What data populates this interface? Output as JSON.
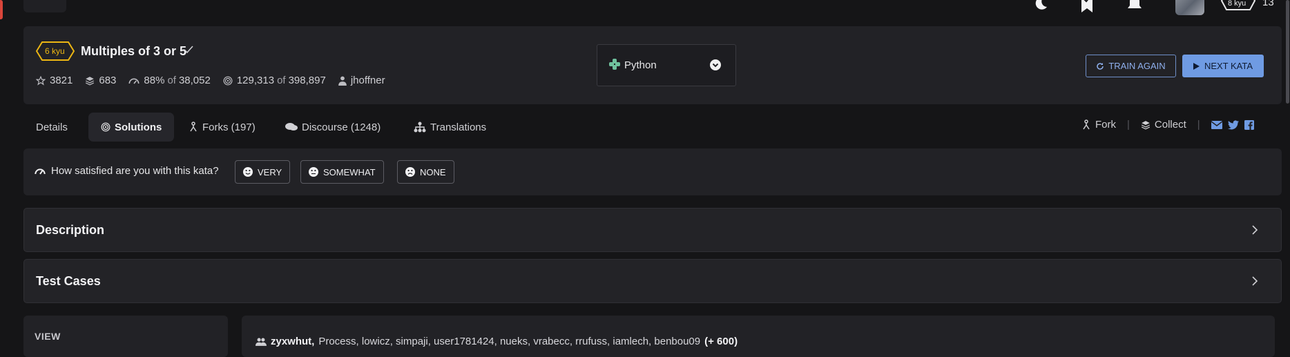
{
  "topbar": {
    "rank_label": "8 kyu",
    "honor": "13",
    "icons": [
      "moon-icon",
      "bookmark-icon",
      "bell-icon",
      "avatar"
    ]
  },
  "kata": {
    "rank": "6 kyu",
    "title": "Multiples of 3 or 5",
    "stats": {
      "stars": "3821",
      "collections": "683",
      "satisfaction": "88%",
      "satisfaction_of": "of",
      "satisfaction_votes": "38,052",
      "completions": "129,313",
      "completions_of": "of",
      "attempts": "398,897",
      "author": "jhoffner"
    }
  },
  "language": {
    "selected": "Python"
  },
  "actions": {
    "train_again": "TRAIN AGAIN",
    "next_kata": "NEXT KATA"
  },
  "tabs": [
    {
      "label": "Details"
    },
    {
      "label": "Solutions"
    },
    {
      "label": "Forks (197)"
    },
    {
      "label": "Discourse (1248)"
    },
    {
      "label": "Translations"
    }
  ],
  "right_actions": {
    "fork": "Fork",
    "collect": "Collect",
    "separator": "|"
  },
  "satisfaction": {
    "question": "How satisfied are you with this kata?",
    "options": [
      "VERY",
      "SOMEWHAT",
      "NONE"
    ]
  },
  "sections": {
    "description": "Description",
    "test_cases": "Test Cases"
  },
  "sidebar": {
    "view_label": "VIEW"
  },
  "solution": {
    "first_author": "zyxwhut,",
    "others": "Process, lowicz, simpaji, user1781424, nueks, vrabecc, rrufuss, iamlech, benbou09",
    "more": "(+ 600)"
  },
  "colors": {
    "background": "#151517",
    "card": "#222226",
    "accent_blue": "#6f9be3",
    "kyu_yellow": "#ecb613",
    "red_strip": "#d9453a"
  }
}
